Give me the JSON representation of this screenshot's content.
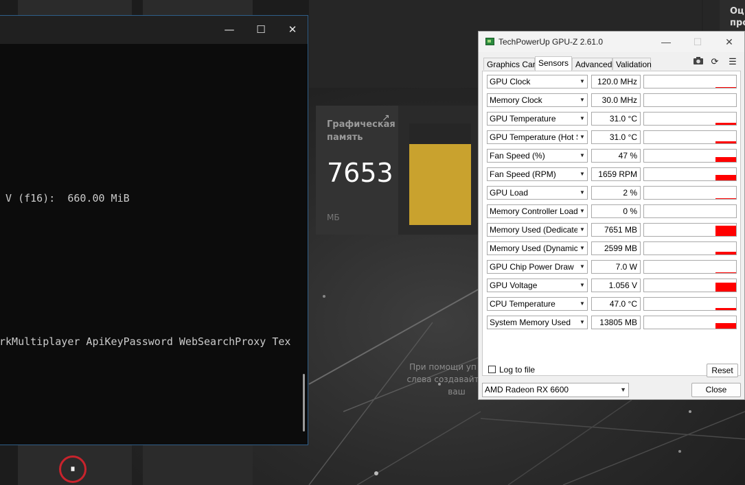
{
  "background_app": {
    "vram_card": {
      "title": "Графическая память",
      "value": "7653",
      "unit": "МБ",
      "fill_fraction": 0.8
    },
    "hint_text_lines": [
      "При помощи уп",
      "слева создавайт",
      "ваш"
    ],
    "right_strip_text_lines": [
      "Оц",
      "про"
    ],
    "recover_label": "⏸"
  },
  "terminal": {
    "lines": [
      {
        "text": " V (f16):  660.00 MiB"
      },
      {
        "text": "rkMultiplayer ApiKeyPassword WebSearchProxy Tex"
      }
    ],
    "controls": {
      "minimize": "—",
      "maximize": "☐",
      "close": "✕"
    }
  },
  "gpuz": {
    "title": "TechPowerUp GPU-Z 2.61.0",
    "window_controls": {
      "minimize": "—",
      "maximize": "☐",
      "close": "✕"
    },
    "tabs": [
      {
        "label": "Graphics Card",
        "active": false
      },
      {
        "label": "Sensors",
        "active": true
      },
      {
        "label": "Advanced",
        "active": false
      },
      {
        "label": "Validation",
        "active": false
      }
    ],
    "toolbar_icons": [
      "camera-icon",
      "refresh-icon",
      "menu-icon"
    ],
    "sensors": [
      {
        "name": "GPU Clock",
        "value": "120.0 MHz",
        "level": 0.05
      },
      {
        "name": "Memory Clock",
        "value": "30.0 MHz",
        "level": 0.0
      },
      {
        "name": "GPU Temperature",
        "value": "31.0 °C",
        "level": 0.15
      },
      {
        "name": "GPU Temperature (Hot Spot)",
        "value": "31.0 °C",
        "level": 0.15
      },
      {
        "name": "Fan Speed (%)",
        "value": "47 %",
        "level": 0.4
      },
      {
        "name": "Fan Speed (RPM)",
        "value": "1659 RPM",
        "level": 0.45
      },
      {
        "name": "GPU Load",
        "value": "2 %",
        "level": 0.05
      },
      {
        "name": "Memory Controller Load",
        "value": "0 %",
        "level": 0.0
      },
      {
        "name": "Memory Used (Dedicated)",
        "value": "7651 MB",
        "level": 0.85
      },
      {
        "name": "Memory Used (Dynamic)",
        "value": "2599 MB",
        "level": 0.25
      },
      {
        "name": "GPU Chip Power Draw",
        "value": "7.0 W",
        "level": 0.05
      },
      {
        "name": "GPU Voltage",
        "value": "1.056 V",
        "level": 0.7
      },
      {
        "name": "CPU Temperature",
        "value": "47.0 °C",
        "level": 0.15
      },
      {
        "name": "System Memory Used",
        "value": "13805 MB",
        "level": 0.45
      }
    ],
    "log_to_file_label": "Log to file",
    "reset_label": "Reset",
    "close_label": "Close",
    "gpu_select_value": "AMD Radeon RX 6600",
    "graph_color": "#ff0000"
  }
}
